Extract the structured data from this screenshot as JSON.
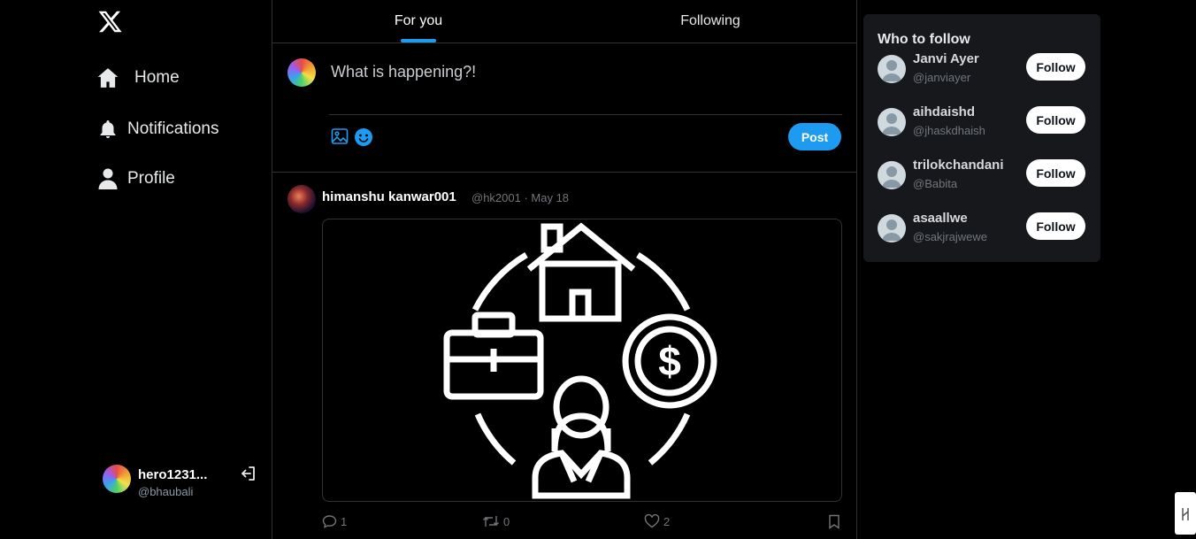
{
  "app": {
    "logo_icon": "x-logo-icon"
  },
  "nav": {
    "items": [
      {
        "label": "Home",
        "icon": "home-icon"
      },
      {
        "label": "Notifications",
        "icon": "bell-icon"
      },
      {
        "label": "Profile",
        "icon": "user-icon"
      }
    ]
  },
  "account": {
    "name": "hero1231...",
    "handle": "@bhaubali",
    "logout_icon": "logout-icon"
  },
  "tabs": [
    {
      "label": "For you",
      "active": true
    },
    {
      "label": "Following",
      "active": false
    }
  ],
  "composer": {
    "placeholder": "What is happening?!",
    "post_label": "Post",
    "accent": "#1d9bf0"
  },
  "tweet": {
    "author": "himanshu kanwar001",
    "meta": "@hk2001 · May 18",
    "image_icon": "career-finance-icon",
    "actions": {
      "replies": "1",
      "retweets": "0",
      "likes": "2"
    }
  },
  "who_to_follow": {
    "title": "Who to follow",
    "follow_label": "Follow",
    "users": [
      {
        "name": "Janvi Ayer",
        "handle": "@janviayer"
      },
      {
        "name": "aihdaishd",
        "handle": "@jhaskdhaish"
      },
      {
        "name": "trilokchandani",
        "handle": "@Babita"
      },
      {
        "name": "asaallwe",
        "handle": "@sakjrajwewe"
      }
    ]
  }
}
